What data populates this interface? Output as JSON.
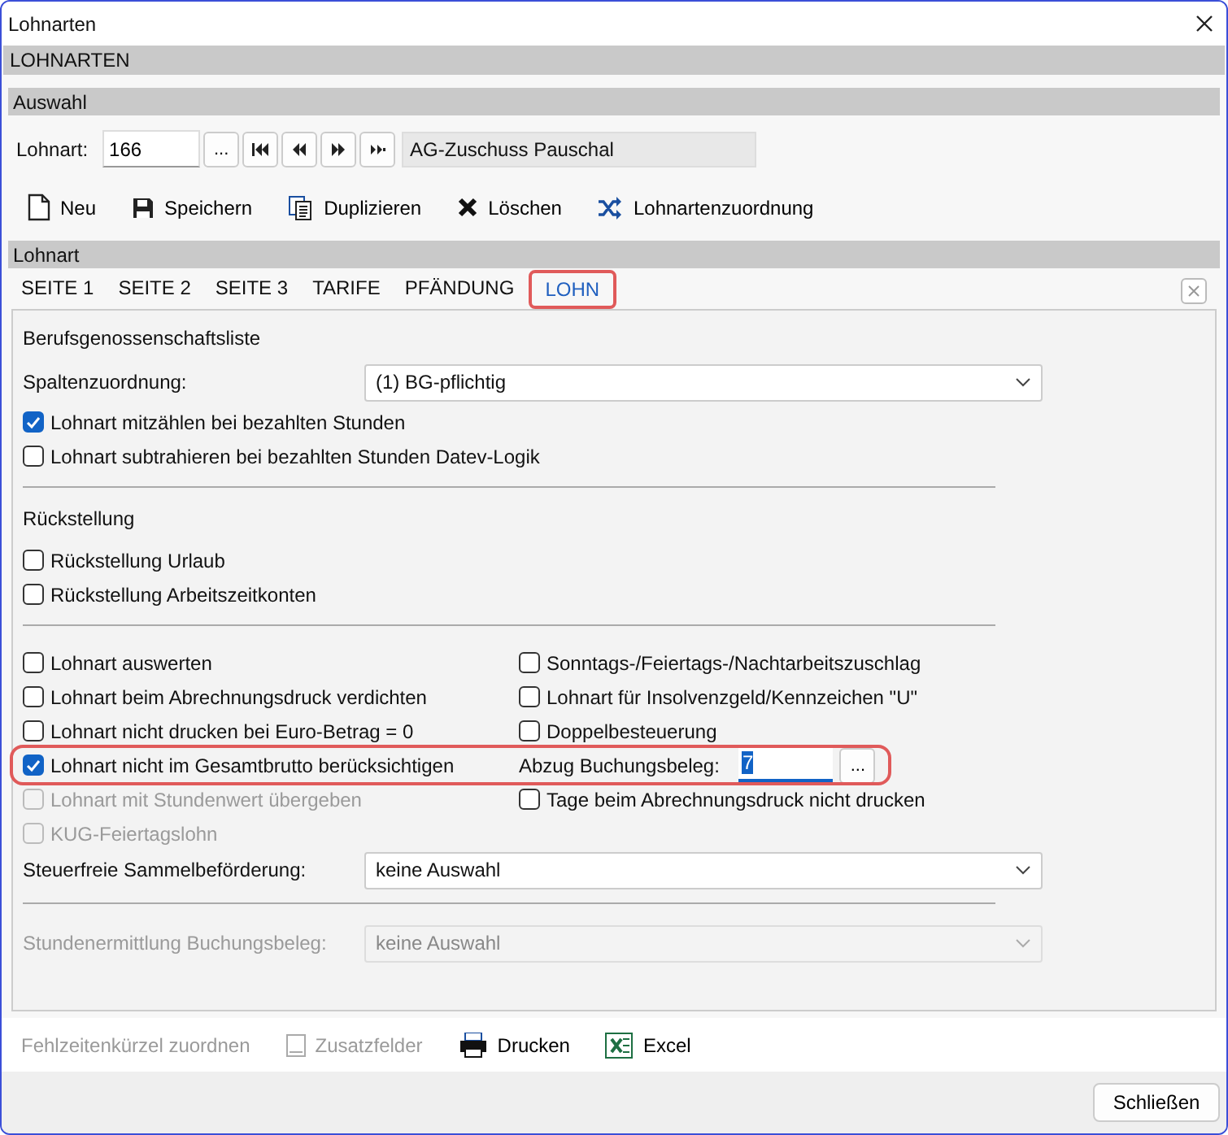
{
  "window": {
    "title": "Lohnarten"
  },
  "header": "LOHNARTEN",
  "auswahl": {
    "title": "Auswahl",
    "label": "Lohnart:",
    "value": "166",
    "browse": "...",
    "name": "AG-Zuschuss Pauschal"
  },
  "toolbar": [
    {
      "kind": "new",
      "label": "Neu"
    },
    {
      "kind": "save",
      "label": "Speichern"
    },
    {
      "kind": "duplicate",
      "label": "Duplizieren"
    },
    {
      "kind": "delete",
      "label": "Löschen"
    },
    {
      "kind": "assign",
      "label": "Lohnartenzuordnung"
    }
  ],
  "section_title": "Lohnart",
  "tabs": [
    {
      "label": "SEITE 1",
      "selected": false,
      "highlighted": false
    },
    {
      "label": "SEITE 2",
      "selected": false,
      "highlighted": false
    },
    {
      "label": "SEITE 3",
      "selected": false,
      "highlighted": false
    },
    {
      "label": "TARIFE",
      "selected": false,
      "highlighted": false
    },
    {
      "label": "PFÄNDUNG",
      "selected": false,
      "highlighted": false
    },
    {
      "label": "LOHN",
      "selected": true,
      "highlighted": true
    }
  ],
  "bg": {
    "heading": "Berufsgenossenschaftsliste",
    "select": {
      "label": "Spaltenzuordnung:",
      "value": "(1) BG-pflichtig",
      "disabled": false
    },
    "checks": [
      {
        "label": "Lohnart mitzählen bei bezahlten Stunden",
        "checked": true,
        "disabled": false
      },
      {
        "label": "Lohnart subtrahieren bei bezahlten Stunden Datev-Logik",
        "checked": false,
        "disabled": false
      }
    ]
  },
  "rueckstellung": {
    "heading": "Rückstellung",
    "checks": [
      {
        "label": "Rückstellung Urlaub",
        "checked": false,
        "disabled": false
      },
      {
        "label": "Rückstellung Arbeitszeitkonten",
        "checked": false,
        "disabled": false
      }
    ]
  },
  "option_rows": [
    {
      "highlighted": false,
      "left": {
        "kind": "checkbox",
        "label": "Lohnart auswerten",
        "checked": false,
        "disabled": false
      },
      "right": {
        "kind": "checkbox",
        "label": "Sonntags-/Feiertags-/Nachtarbeitszuschlag",
        "checked": false,
        "disabled": false
      }
    },
    {
      "highlighted": false,
      "left": {
        "kind": "checkbox",
        "label": "Lohnart beim Abrechnungsdruck verdichten",
        "checked": false,
        "disabled": false
      },
      "right": {
        "kind": "checkbox",
        "label": "Lohnart für Insolvenzgeld/Kennzeichen \"U\"",
        "checked": false,
        "disabled": false
      }
    },
    {
      "highlighted": false,
      "left": {
        "kind": "checkbox",
        "label": "Lohnart nicht drucken bei Euro-Betrag = 0",
        "checked": false,
        "disabled": false
      },
      "right": {
        "kind": "checkbox",
        "label": "Doppelbesteuerung",
        "checked": false,
        "disabled": false
      }
    },
    {
      "highlighted": true,
      "left": {
        "kind": "checkbox",
        "label": "Lohnart nicht im Gesamtbrutto berücksichtigen",
        "checked": true,
        "disabled": false
      },
      "right": {
        "kind": "field",
        "label": "Abzug Buchungsbeleg:",
        "value": "7",
        "button": "..."
      }
    },
    {
      "highlighted": false,
      "left": {
        "kind": "checkbox",
        "label": "Lohnart mit Stundenwert übergeben",
        "checked": false,
        "disabled": true
      },
      "right": {
        "kind": "checkbox",
        "label": "Tage beim Abrechnungsdruck nicht drucken",
        "checked": false,
        "disabled": false
      }
    },
    {
      "highlighted": false,
      "left": {
        "kind": "checkbox",
        "label": "KUG-Feiertagslohn",
        "checked": false,
        "disabled": true
      }
    }
  ],
  "sammel": {
    "label": "Steuerfreie Sammelbeförderung:",
    "value": "keine Auswahl",
    "disabled": false
  },
  "stunden": {
    "label": "Stundenermittlung Buchungsbeleg:",
    "value": "keine Auswahl",
    "disabled": true
  },
  "bottom_actions": [
    {
      "kind": "plain",
      "label": "Fehlzeitenkürzel zuordnen",
      "disabled": true
    },
    {
      "kind": "fields",
      "label": "Zusatzfelder",
      "disabled": true
    },
    {
      "kind": "print",
      "label": "Drucken",
      "disabled": false
    },
    {
      "kind": "excel",
      "label": "Excel",
      "disabled": false
    }
  ],
  "close_button": "Schließen"
}
